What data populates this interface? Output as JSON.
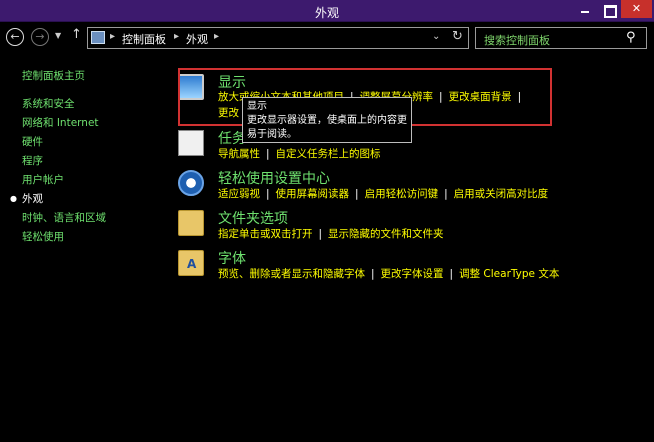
{
  "window": {
    "title": "外观"
  },
  "address_bar": {
    "crumbs": [
      "控制面板",
      "外观"
    ],
    "search_placeholder": "搜索控制面板"
  },
  "sidebar": {
    "items": [
      {
        "label": "控制面板主页"
      },
      {
        "label": "系统和安全"
      },
      {
        "label": "网络和 Internet"
      },
      {
        "label": "硬件"
      },
      {
        "label": "程序"
      },
      {
        "label": "用户帐户"
      },
      {
        "label": "外观",
        "current": true
      },
      {
        "label": "时钟、语言和区域"
      },
      {
        "label": "轻松使用"
      }
    ]
  },
  "categories": [
    {
      "title": "显示",
      "icon": "monitor-icon",
      "links": [
        "放大或缩小文本和其他项目",
        "调整屏幕分辨率",
        "更改桌面背景"
      ],
      "links2": [
        "更改"
      ]
    },
    {
      "title": "任务",
      "icon": "taskbar-icon",
      "links": [
        "导航属性",
        "自定义任务栏上的图标"
      ]
    },
    {
      "title": "轻松使用设置中心",
      "icon": "ease-of-access-icon",
      "links": [
        "适应弱视",
        "使用屏幕阅读器",
        "启用轻松访问键",
        "启用或关闭高对比度"
      ]
    },
    {
      "title": "文件夹选项",
      "icon": "folder-icon",
      "links": [
        "指定单击或双击打开",
        "显示隐藏的文件和文件夹"
      ]
    },
    {
      "title": "字体",
      "icon": "font-icon",
      "links": [
        "预览、删除或者显示和隐藏字体",
        "更改字体设置",
        "调整 ClearType 文本"
      ]
    }
  ],
  "tooltip": {
    "lines": [
      "显示",
      "更改显示器设置，使桌面上的内容更",
      "易于阅读。"
    ]
  }
}
